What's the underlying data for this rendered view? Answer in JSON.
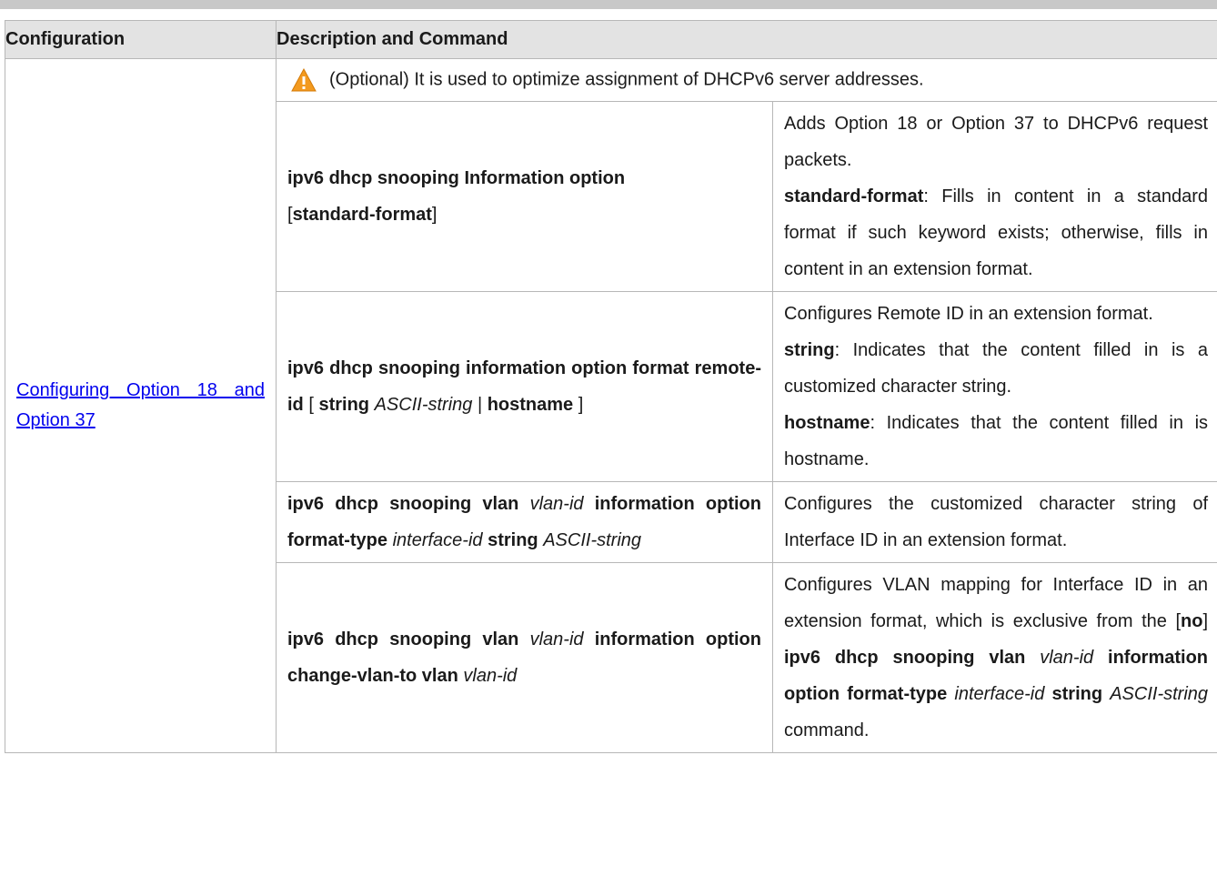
{
  "header": {
    "col1": "Configuration",
    "col2": "Description and Command"
  },
  "configuration_link": "Configuring Option 18 and Option 37",
  "note": {
    "icon": "warning-icon",
    "text": "(Optional) It is used to optimize assignment of DHCPv6 server addresses."
  },
  "rows": [
    {
      "command": {
        "a": "ipv6 dhcp snooping  Information option",
        "b": "[",
        "c": "standard-format",
        "d": "]"
      },
      "description": {
        "p1": "Adds Option 18 or Option 37 to DHCPv6 request packets.",
        "k1": "standard-format",
        "p2": ": Fills in content in a standard format if such keyword exists; otherwise, fills in content in an extension format."
      }
    },
    {
      "command": {
        "a": "ipv6 dhcp snooping information option format remote-id",
        "b": " [ ",
        "c": "string",
        "d": "ASCII-string",
        "e": " | ",
        "f": "hostname",
        "g": " ]"
      },
      "description": {
        "p1": "Configures Remote ID in an extension format.",
        "k1": "string",
        "p2": ": Indicates that the content filled in is a customized character string.",
        "k2": "hostname",
        "p3": ": Indicates that the content filled in is hostname."
      }
    },
    {
      "command": {
        "a": "ipv6 dhcp snooping vlan",
        "b": "vlan-id",
        "c": "information option format-type",
        "d": "interface-id",
        "e": "string",
        "f": "ASCII-string"
      },
      "description": {
        "p1": "Configures the customized character string of Interface ID in an extension format."
      }
    },
    {
      "command": {
        "a": "ipv6 dhcp snooping vlan",
        "b": "vlan-id",
        "c": "information option change-vlan-to vlan",
        "d": "vlan-id"
      },
      "description": {
        "p1": "Configures VLAN mapping for Interface ID in an extension format, which is exclusive from the [",
        "k1": "no",
        "p2": "] ",
        "k2": "ipv6 dhcp snooping vlan",
        "i1": "vlan-id",
        "k3": "information option format-type",
        "i2": "interface-id",
        "k4": "string",
        "i3": "ASCII-string",
        "p3": " command."
      }
    }
  ]
}
